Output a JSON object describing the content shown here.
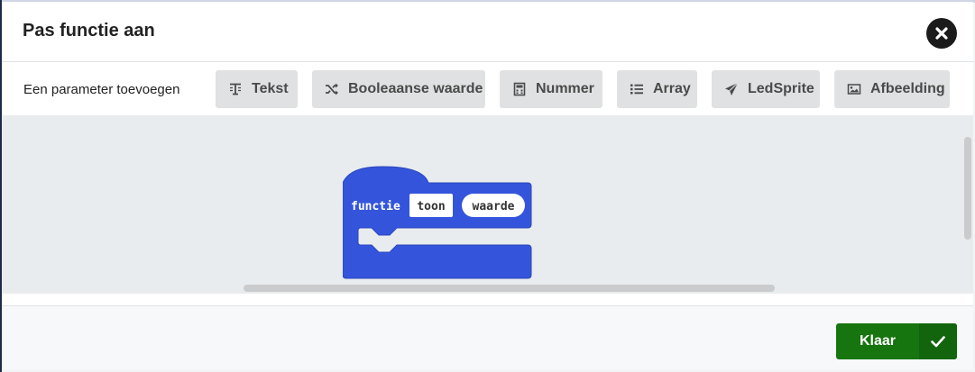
{
  "dialog": {
    "title": "Pas functie aan",
    "close_icon": "close-icon"
  },
  "toolbar": {
    "label": "Een parameter toevoegen",
    "buttons": [
      {
        "label": "Tekst",
        "icon": "text-icon"
      },
      {
        "label": "Booleaanse waarde",
        "icon": "shuffle-icon"
      },
      {
        "label": "Nummer",
        "icon": "calculator-icon"
      },
      {
        "label": "Array",
        "icon": "list-icon"
      },
      {
        "label": "LedSprite",
        "icon": "send-icon"
      },
      {
        "label": "Afbeelding",
        "icon": "image-icon"
      }
    ]
  },
  "block": {
    "keyword": "functie",
    "name": "toon",
    "param": "waarde",
    "color": "#3455db"
  },
  "footer": {
    "done_label": "Klaar",
    "done_color": "#16750f"
  }
}
